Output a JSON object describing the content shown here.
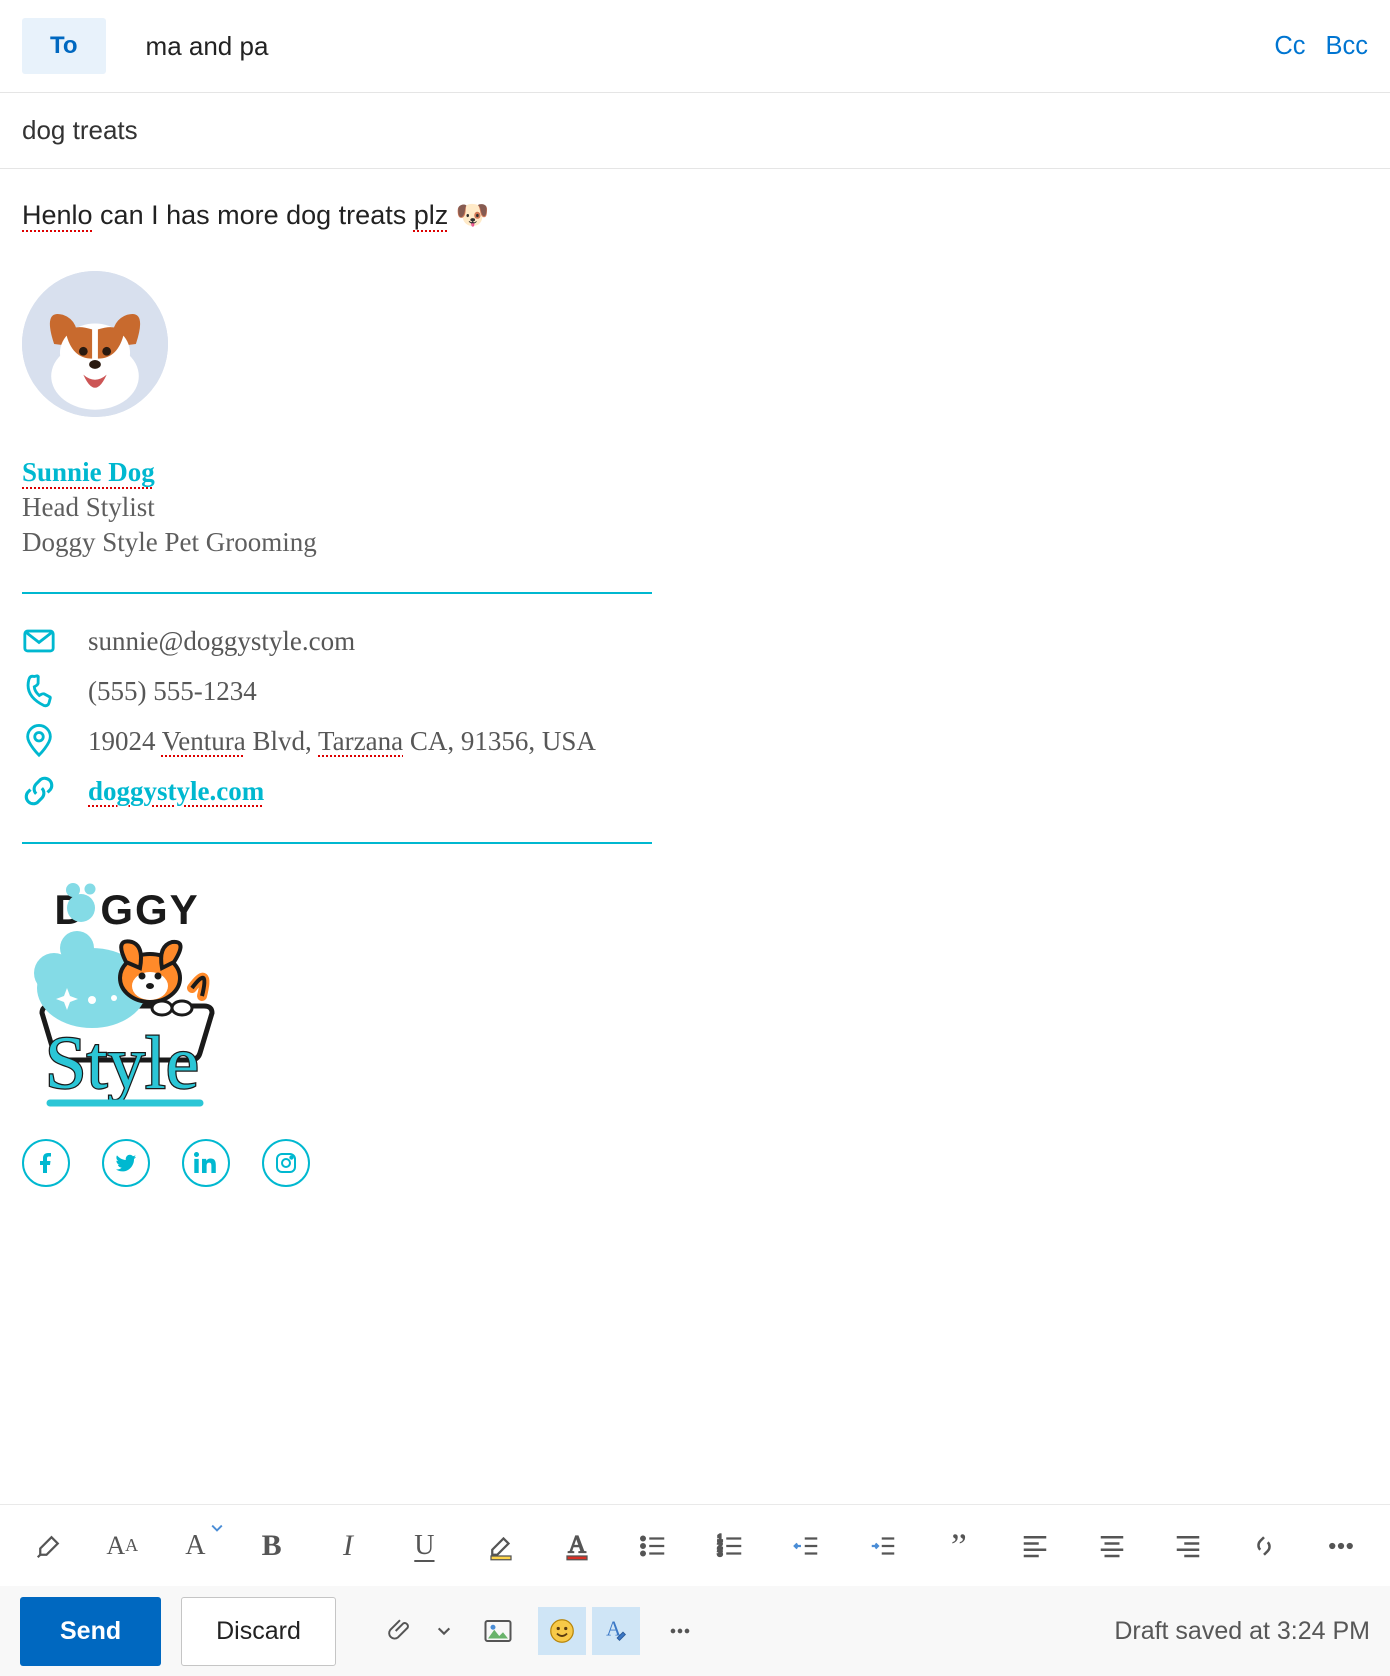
{
  "colors": {
    "accent_teal": "#00b8d0",
    "link_blue": "#0075d1",
    "primary_blue": "#0068c0",
    "to_chip_bg": "#e8f2fb"
  },
  "compose": {
    "to_label": "To",
    "recipients": "ma and pa",
    "cc_label": "Cc",
    "bcc_label": "Bcc",
    "subject": "dog treats",
    "body_line_prefix": "Henlo",
    "body_line_mid": " can I has more dog treats ",
    "body_line_misspelled2": "plz",
    "body_emoji": "🐶"
  },
  "signature": {
    "name": "Sunnie Dog",
    "title": "Head Stylist",
    "company": "Doggy Style Pet Grooming",
    "email": "sunnie@doggystyle.com",
    "phone": "(555) 555-1234",
    "address_p1": "19024 ",
    "address_ventura": "Ventura",
    "address_p2": " Blvd, ",
    "address_tarzana": "Tarzana",
    "address_p3": " CA, 91356, USA",
    "website": "doggystyle.com",
    "logo_top": "DOGGY",
    "logo_bottom": "Style"
  },
  "actions": {
    "send": "Send",
    "discard": "Discard"
  },
  "status": "Draft saved at 3:24 PM",
  "format_toolbar_icons": [
    "format-painter",
    "font-size",
    "font-style",
    "bold",
    "italic",
    "underline",
    "highlight",
    "font-color",
    "bullets",
    "numbering",
    "decrease-indent",
    "increase-indent",
    "quote",
    "align-left",
    "align-center",
    "align-right",
    "insert-link",
    "more"
  ]
}
